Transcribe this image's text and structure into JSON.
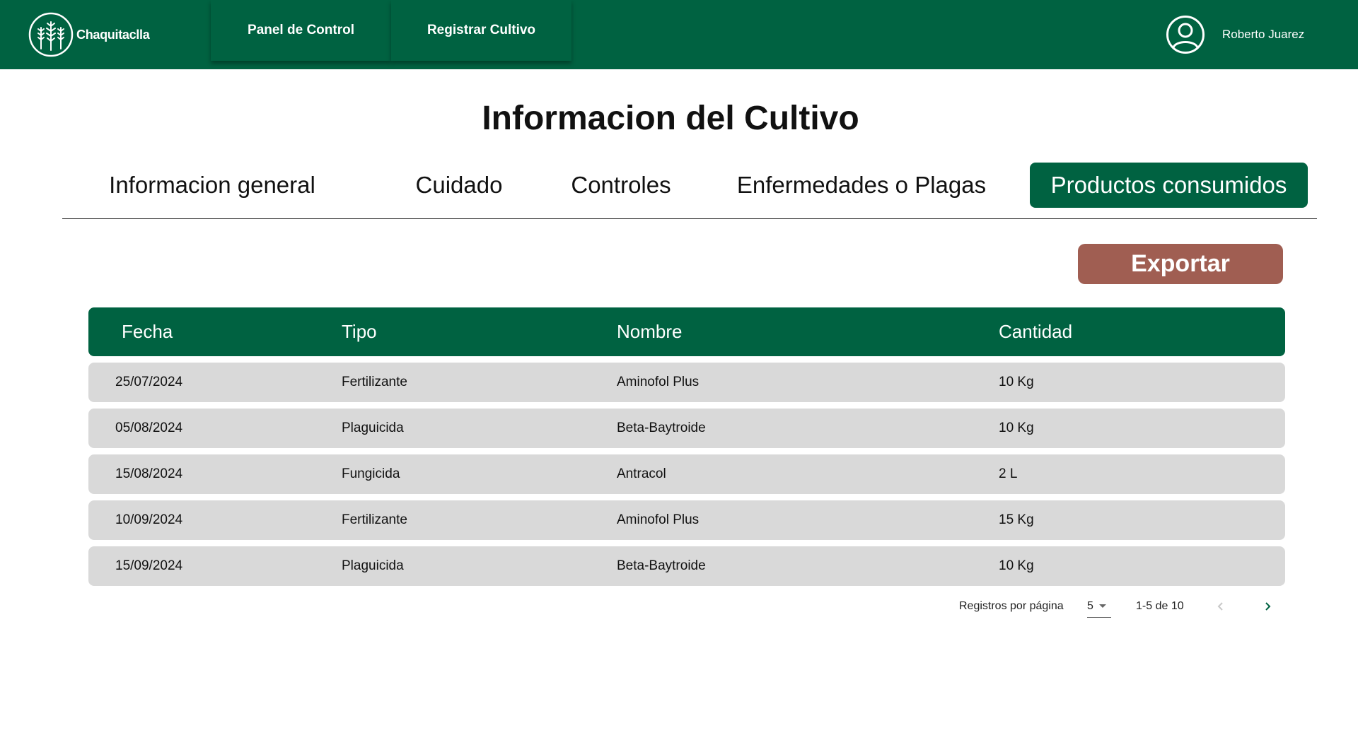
{
  "header": {
    "logo_text": "Chaquitaclla",
    "nav": [
      {
        "label": "Panel de Control"
      },
      {
        "label": "Registrar Cultivo"
      }
    ],
    "user_name": "Roberto Juarez"
  },
  "page": {
    "title": "Informacion del Cultivo",
    "tabs": [
      {
        "label": "Informacion general",
        "active": false
      },
      {
        "label": "Cuidado",
        "active": false
      },
      {
        "label": "Controles",
        "active": false
      },
      {
        "label": "Enfermedades o Plagas",
        "active": false
      },
      {
        "label": "Productos consumidos",
        "active": true
      }
    ],
    "export_label": "Exportar"
  },
  "table": {
    "columns": [
      "Fecha",
      "Tipo",
      "Nombre",
      "Cantidad"
    ],
    "rows": [
      [
        "25/07/2024",
        "Fertilizante",
        "Aminofol Plus",
        "10 Kg"
      ],
      [
        "05/08/2024",
        "Plaguicida",
        "Beta-Baytroide",
        "10 Kg"
      ],
      [
        "15/08/2024",
        "Fungicida",
        "Antracol",
        "2 L"
      ],
      [
        "10/09/2024",
        "Fertilizante",
        "Aminofol Plus",
        "15 Kg"
      ],
      [
        "15/09/2024",
        "Plaguicida",
        "Beta-Baytroide",
        "10 Kg"
      ]
    ]
  },
  "pagination": {
    "per_page_label": "Registros por página",
    "per_page_value": "5",
    "range_label": "1-5 de 10",
    "prev_icon": "chevron-left-icon",
    "next_icon": "chevron-right-icon"
  },
  "colors": {
    "brand_green": "#006241",
    "export_brown": "#a05e52",
    "row_gray": "#d9d9d9"
  }
}
